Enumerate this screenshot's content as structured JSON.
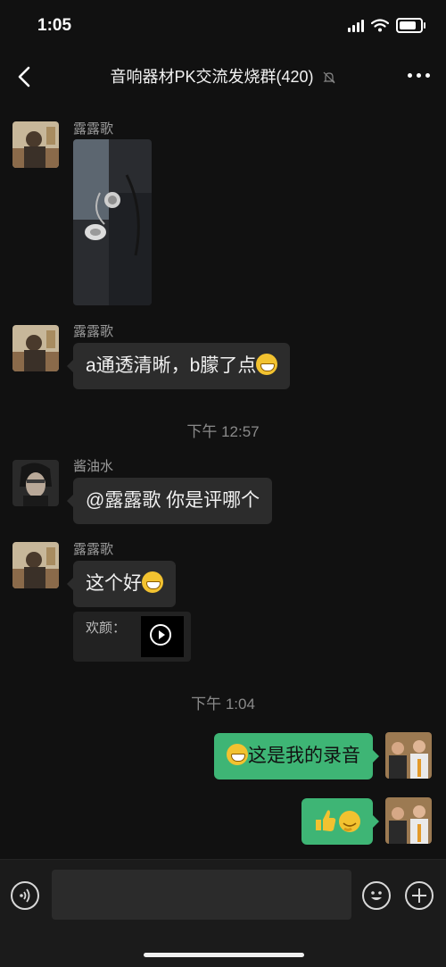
{
  "status": {
    "time": "1:05"
  },
  "nav": {
    "title": "音响器材PK交流发烧群(420)"
  },
  "messages": [
    {
      "sender": "露露歌",
      "type": "image"
    },
    {
      "sender": "露露歌",
      "text": "a通透清晰，b朦了点"
    },
    {
      "sender": "酱油水",
      "text": "@露露歌 你是评哪个"
    },
    {
      "sender": "露露歌",
      "text": "这个好",
      "quote": "欢颜："
    },
    {
      "text": "这是我的录音"
    }
  ],
  "timestamps": [
    "下午 12:57",
    "下午 1:04"
  ],
  "input": {
    "value": ""
  },
  "colors": {
    "background": "#111111",
    "bubble_incoming": "#2c2c2c",
    "bubble_outgoing": "#3eb575"
  }
}
